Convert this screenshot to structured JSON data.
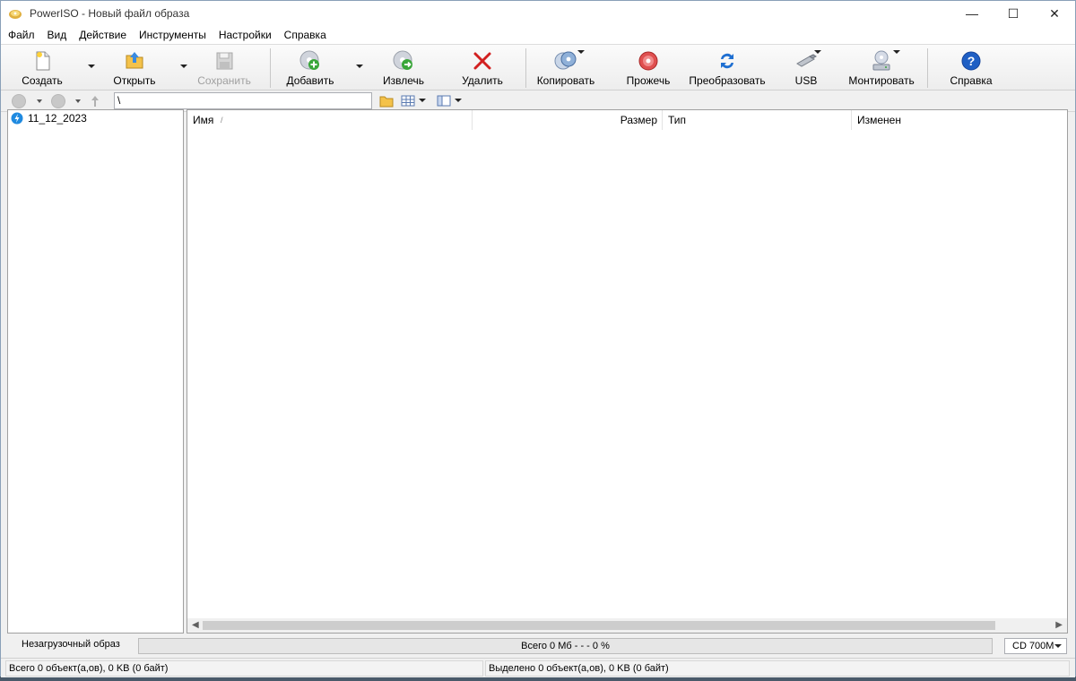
{
  "window": {
    "title": "PowerISO - Новый файл образа",
    "controls": {
      "minimize": "—",
      "maximize": "☐",
      "close": "✕"
    }
  },
  "menu": [
    "Файл",
    "Вид",
    "Действие",
    "Инструменты",
    "Настройки",
    "Справка"
  ],
  "toolbar": {
    "create": "Создать",
    "open": "Открыть",
    "save": "Сохранить",
    "add": "Добавить",
    "extract": "Извлечь",
    "delete": "Удалить",
    "copy": "Копировать",
    "burn": "Прожечь",
    "convert": "Преобразовать",
    "usb": "USB",
    "mount": "Монтировать",
    "help": "Справка"
  },
  "address": {
    "path": "\\"
  },
  "tree": {
    "items": [
      {
        "label": "11_12_2023",
        "icon": "disc-image-icon"
      }
    ]
  },
  "list": {
    "columns": {
      "name": "Имя",
      "sort_indicator": "/",
      "size": "Размер",
      "type": "Тип",
      "modified": "Изменен"
    },
    "rows": []
  },
  "status": {
    "boot_type": "Незагрузочный образ",
    "progress_text": "Всего  0 Мб   - - -  0 %",
    "media": "CD 700M",
    "total": "Всего 0 объект(а,ов), 0 KB (0 байт)",
    "selected": "Выделено 0 объект(а,ов), 0 KB (0 байт)"
  },
  "colors": {
    "accent_blue": "#1f6fd1",
    "delete_red": "#d22020",
    "add_green": "#3aa63a"
  }
}
